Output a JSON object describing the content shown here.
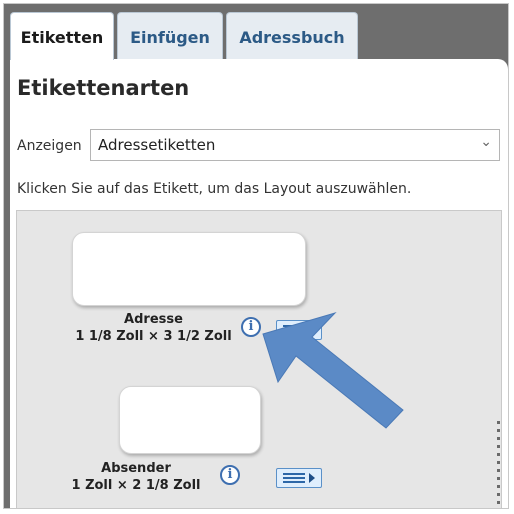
{
  "tabs": [
    {
      "label": "Etiketten",
      "active": true
    },
    {
      "label": "Einfügen",
      "active": false
    },
    {
      "label": "Adressbuch",
      "active": false
    }
  ],
  "pane": {
    "title": "Etikettenarten",
    "show_label": "Anzeigen",
    "select_value": "Adressetiketten",
    "hint": "Klicken Sie auf das Etikett, um das Layout auszuwählen."
  },
  "labels": [
    {
      "name": "Adresse",
      "size": "1 1/8 Zoll × 3 1/2 Zoll",
      "info_icon": "info-icon",
      "detail_icon": "label-details-icon"
    },
    {
      "name": "Absender",
      "size": "1 Zoll × 2 1/8 Zoll",
      "info_icon": "info-icon",
      "detail_icon": "label-details-icon"
    }
  ],
  "colors": {
    "tab_text": "#2c5a86",
    "annotation_arrow": "#5b8ac6",
    "frame_background": "#6e6e6e"
  }
}
